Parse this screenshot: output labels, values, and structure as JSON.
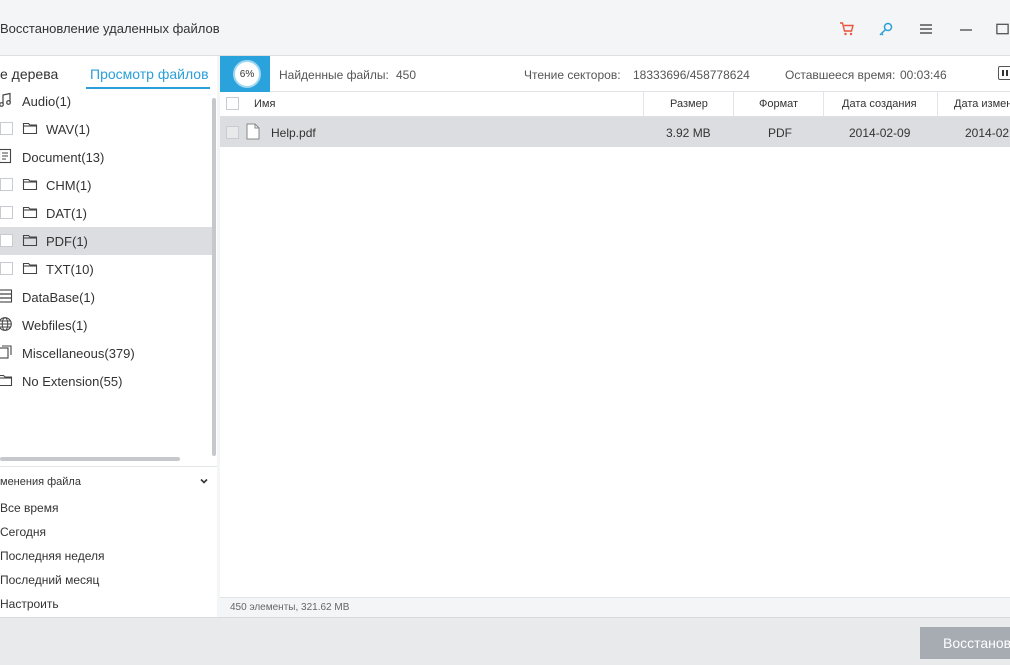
{
  "window": {
    "title": "Восстановление удаленных файлов"
  },
  "titlebar": {
    "icons": [
      "cart-icon",
      "key-icon",
      "menu-icon",
      "minimize-icon",
      "maximize-icon"
    ],
    "accent_cart": "#e8543c",
    "accent_key": "#2a9fd8"
  },
  "tabs": {
    "tree_label": "е дерева",
    "files_label": "Просмотр файлов"
  },
  "tree": {
    "items": [
      {
        "label": "Audio(1)",
        "icon": "music-icon",
        "level": 0,
        "selected": false
      },
      {
        "label": "WAV(1)",
        "icon": "folder-icon",
        "level": 1,
        "selected": false
      },
      {
        "label": "Document(13)",
        "icon": "document-icon",
        "level": 0,
        "selected": false
      },
      {
        "label": "CHM(1)",
        "icon": "folder-icon",
        "level": 1,
        "selected": false
      },
      {
        "label": "DAT(1)",
        "icon": "folder-icon",
        "level": 1,
        "selected": false
      },
      {
        "label": "PDF(1)",
        "icon": "folder-icon",
        "level": 1,
        "selected": true
      },
      {
        "label": "TXT(10)",
        "icon": "folder-icon",
        "level": 1,
        "selected": false
      },
      {
        "label": "DataBase(1)",
        "icon": "database-icon",
        "level": 0,
        "selected": false
      },
      {
        "label": "Webfiles(1)",
        "icon": "globe-icon",
        "level": 0,
        "selected": false
      },
      {
        "label": "Miscellaneous(379)",
        "icon": "misc-icon",
        "level": 0,
        "selected": false
      },
      {
        "label": "No Extension(55)",
        "icon": "folder-icon",
        "level": 0,
        "selected": false
      }
    ]
  },
  "filter": {
    "title": "менения файла",
    "items": [
      "Все время",
      "Сегодня",
      "Последняя неделя",
      "Последний месяц",
      "Настроить"
    ]
  },
  "scan": {
    "percent": "6%",
    "found_label": "Найденные файлы:",
    "found_value": "450",
    "sectors_label": "Чтение секторов:",
    "sectors_value": "18333696/458778624",
    "remaining_label": "Оставшееся время:",
    "remaining_value": "00:03:46",
    "accent": "#2aa3dc"
  },
  "table": {
    "headers": {
      "name": "Имя",
      "size": "Размер",
      "format": "Формат",
      "created": "Дата создания",
      "modified": "Дата измен"
    },
    "rows": [
      {
        "name": "Help.pdf",
        "size": "3.92 MB",
        "format": "PDF",
        "created": "2014-02-09",
        "modified": "2014-02"
      }
    ]
  },
  "status": {
    "text": "450 элементы, 321.62 MB"
  },
  "actions": {
    "recover_label": "Восстанов"
  }
}
